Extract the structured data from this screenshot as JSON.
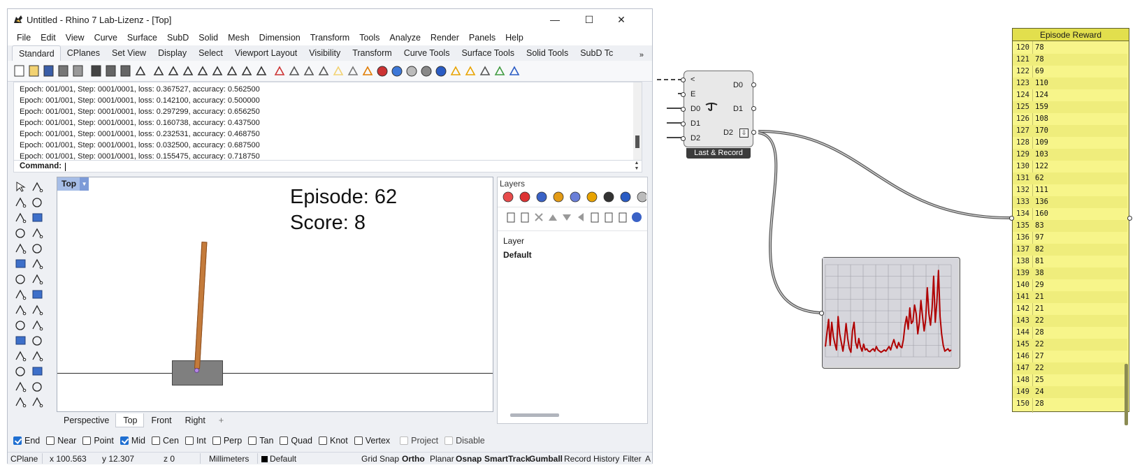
{
  "window": {
    "title": "Untitled - Rhino 7 Lab-Lizenz - [Top]",
    "minimize": "—",
    "maximize": "☐",
    "close": "✕"
  },
  "menu": [
    "File",
    "Edit",
    "View",
    "Curve",
    "Surface",
    "SubD",
    "Solid",
    "Mesh",
    "Dimension",
    "Transform",
    "Tools",
    "Analyze",
    "Render",
    "Panels",
    "Help"
  ],
  "toolbar_tabs": {
    "items": [
      "Standard",
      "CPlanes",
      "Set View",
      "Display",
      "Select",
      "Viewport Layout",
      "Visibility",
      "Transform",
      "Curve Tools",
      "Surface Tools",
      "Solid Tools",
      "SubD Tc"
    ],
    "active": "Standard",
    "overflow": "»"
  },
  "command_history": [
    "Epoch: 001/001, Step: 0001/0001, loss: 0.367527, accuracy: 0.562500",
    "Epoch: 001/001, Step: 0001/0001, loss: 0.142100, accuracy: 0.500000",
    "Epoch: 001/001, Step: 0001/0001, loss: 0.297299, accuracy: 0.656250",
    "Epoch: 001/001, Step: 0001/0001, loss: 0.160738, accuracy: 0.437500",
    "Epoch: 001/001, Step: 0001/0001, loss: 0.232531, accuracy: 0.468750",
    "Epoch: 001/001, Step: 0001/0001, loss: 0.032500, accuracy: 0.687500",
    "Epoch: 001/001, Step: 0001/0001, loss: 0.155475, accuracy: 0.718750"
  ],
  "command": {
    "label": "Command:",
    "value": ""
  },
  "viewport": {
    "name": "Top",
    "episode_text": "Episode: 62",
    "score_text": "Score: 8",
    "pole_angle_deg": 3.3
  },
  "viewport_tabs": {
    "items": [
      "Perspective",
      "Top",
      "Front",
      "Right"
    ],
    "active": "Top",
    "add": "+"
  },
  "layers": {
    "title": "Layers",
    "column_header": "Layer",
    "rows": [
      "Default"
    ]
  },
  "osnap": [
    {
      "label": "End",
      "checked": true
    },
    {
      "label": "Near",
      "checked": false
    },
    {
      "label": "Point",
      "checked": false
    },
    {
      "label": "Mid",
      "checked": true
    },
    {
      "label": "Cen",
      "checked": false
    },
    {
      "label": "Int",
      "checked": false
    },
    {
      "label": "Perp",
      "checked": false
    },
    {
      "label": "Tan",
      "checked": false
    },
    {
      "label": "Quad",
      "checked": false
    },
    {
      "label": "Knot",
      "checked": false
    },
    {
      "label": "Vertex",
      "checked": false
    },
    {
      "label": "Project",
      "checked": false,
      "disabled": true
    },
    {
      "label": "Disable",
      "checked": false,
      "disabled": true
    }
  ],
  "status": {
    "cplane": "CPlane",
    "x": "x 100.563",
    "y": "y 12.307",
    "z": "z 0",
    "units": "Millimeters",
    "layer": "Default",
    "toggles": [
      {
        "label": "Grid Snap",
        "bold": false
      },
      {
        "label": "Ortho",
        "bold": true
      },
      {
        "label": "Planar",
        "bold": false
      },
      {
        "label": "Osnap",
        "bold": true
      },
      {
        "label": "SmartTrack",
        "bold": true
      },
      {
        "label": "Gumball",
        "bold": true
      },
      {
        "label": "Record History",
        "bold": false
      },
      {
        "label": "Filter",
        "bold": false
      },
      {
        "label": "A",
        "bold": false
      }
    ]
  },
  "gh_component": {
    "label": "Last & Record",
    "inputs": [
      "<",
      "E",
      "D0",
      "D1",
      "D2"
    ],
    "outputs": [
      "D0",
      "D1",
      "D2"
    ],
    "download_icon": "⇩"
  },
  "gh_panel": {
    "title": "Episode Reward",
    "rows": [
      [
        "120",
        "78"
      ],
      [
        "121",
        "78"
      ],
      [
        "122",
        "69"
      ],
      [
        "123",
        "110"
      ],
      [
        "124",
        "124"
      ],
      [
        "125",
        "159"
      ],
      [
        "126",
        "108"
      ],
      [
        "127",
        "170"
      ],
      [
        "128",
        "109"
      ],
      [
        "129",
        "103"
      ],
      [
        "130",
        "122"
      ],
      [
        "131",
        "62"
      ],
      [
        "132",
        "111"
      ],
      [
        "133",
        "136"
      ],
      [
        "134",
        "160"
      ],
      [
        "135",
        "83"
      ],
      [
        "136",
        "97"
      ],
      [
        "137",
        "82"
      ],
      [
        "138",
        "81"
      ],
      [
        "139",
        "38"
      ],
      [
        "140",
        "29"
      ],
      [
        "141",
        "21"
      ],
      [
        "142",
        "21"
      ],
      [
        "143",
        "22"
      ],
      [
        "144",
        "28"
      ],
      [
        "145",
        "22"
      ],
      [
        "146",
        "27"
      ],
      [
        "147",
        "22"
      ],
      [
        "148",
        "25"
      ],
      [
        "149",
        "24"
      ],
      [
        "150",
        "28"
      ]
    ]
  },
  "chart_data": {
    "type": "line",
    "title": "",
    "xlabel": "",
    "ylabel": "",
    "grid": true,
    "series_color": "#b00000",
    "values": [
      18,
      42,
      65,
      20,
      60,
      35,
      22,
      12,
      70,
      40,
      25,
      10,
      28,
      58,
      32,
      15,
      8,
      45,
      60,
      25,
      15,
      32,
      18,
      10,
      22,
      12,
      14,
      10,
      9,
      12,
      14,
      10,
      18,
      12,
      10,
      8,
      10,
      12,
      10,
      14,
      18,
      12,
      22,
      30,
      20,
      15,
      25,
      18,
      16,
      30,
      55,
      70,
      48,
      85,
      58,
      62,
      90,
      75,
      40,
      60,
      98,
      70,
      45,
      65,
      120,
      75,
      55,
      85,
      140,
      60,
      95,
      150,
      70,
      40,
      20,
      10,
      12,
      14,
      10,
      12
    ],
    "ylim": [
      0,
      160
    ]
  }
}
